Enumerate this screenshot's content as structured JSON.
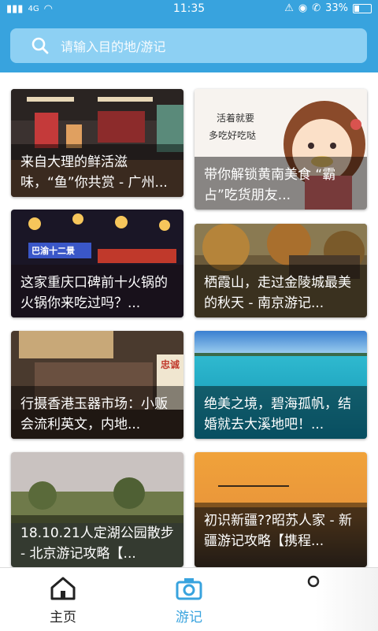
{
  "status": {
    "time": "11:35",
    "battery": "33%",
    "signal": "4G"
  },
  "search": {
    "placeholder": "请输入目的地/游记"
  },
  "cards": [
    {
      "title": "来自大理的鲜活滋味，“鱼”你共赏 - 广州..."
    },
    {
      "title": "带你解锁黄南美食 “霸占”吃货朋友..."
    },
    {
      "title": "这家重庆口碑前十火锅的火锅你来吃过吗？..."
    },
    {
      "title": "栖霞山，走过金陵城最美的秋天 - 南京游记..."
    },
    {
      "title": "行摄香港玉器市场：小贩会流利英文，内地..."
    },
    {
      "title": "绝美之境，碧海孤帆，结婚就去大溪地吧！..."
    },
    {
      "title": "18.10.21人定湖公园散步 - 北京游记攻略【..."
    },
    {
      "title": "初识新疆??昭苏人家 - 新疆游记攻略【携程..."
    }
  ],
  "card2_overlay": {
    "line1": "活着就要",
    "line2": "多吃好吃哒"
  },
  "card3_sign": "巴渝十二景",
  "card5_sign": "忠诚",
  "tabs": [
    {
      "label": "主页",
      "active": false
    },
    {
      "label": "游记",
      "active": true
    }
  ],
  "colors": {
    "accent": "#38a3de",
    "active_tab": "#38a3de",
    "inactive_tab": "#222222"
  }
}
